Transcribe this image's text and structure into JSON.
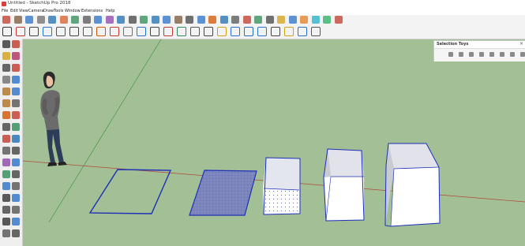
{
  "window": {
    "title": "Untitled - SketchUp Pro 2018"
  },
  "menubar": {
    "items": [
      "File",
      "Edit",
      "View",
      "Camera",
      "Draw",
      "Tools",
      "Window",
      "Extensions",
      "Help"
    ]
  },
  "toolbar_row1": {
    "icon_colors": [
      "#c0392b",
      "#7a5a3a",
      "#2a72c8",
      "#6e6e6e",
      "#1f6fb2",
      "#d65f2e",
      "#2e8b57",
      "#555555",
      "#2a72c8",
      "#8e44ad",
      "#1f6fb2",
      "#444444",
      "#2e8b57",
      "#1f6fb2",
      "#2a72c8",
      "#7a5a3a",
      "#444444",
      "#2a72c8",
      "#d35400",
      "#1f6fb2",
      "#555555",
      "#c0392b",
      "#2e8b57",
      "#444444",
      "#d4a017",
      "#2a72c8",
      "#e67e22",
      "#1fb1c8",
      "#27ae60",
      "#c0392b"
    ]
  },
  "toolbar_row2": {
    "icon_colors": [
      "#333333",
      "#c0392b",
      "#444444",
      "#2a72c8",
      "#555555",
      "#444444",
      "#555555",
      "#d35400",
      "#c0392b",
      "#6e6e6e",
      "#2a72c8",
      "#444444",
      "#c0392b",
      "#2e8b57",
      "#555555",
      "#444444",
      "#d4a017",
      "#2a72c8",
      "#1f6fb2",
      "#2a72c8",
      "#444444",
      "#d4a017",
      "#2a72c8",
      "#555555"
    ]
  },
  "left_toolbar": {
    "icon_colors": [
      "#333333",
      "#c0392b",
      "#d4a017",
      "#b03060",
      "#444444",
      "#c0392b",
      "#6e6e6e",
      "#2a72c8",
      "#b07020",
      "#2a72c8",
      "#b07020",
      "#555555",
      "#d35400",
      "#c0392b",
      "#444444",
      "#2e8b57",
      "#c0392b",
      "#1f6fb2",
      "#555555",
      "#444444",
      "#8e44ad",
      "#2a72c8",
      "#2e8b57",
      "#444444",
      "#2a72c8",
      "#555555",
      "#333333",
      "#2a72c8",
      "#444444",
      "#555555",
      "#333333",
      "#2a72c8",
      "#555555",
      "#444444"
    ]
  },
  "tray": {
    "title": "Selection Toys",
    "close_glyph": "×",
    "icons": [
      "select-all-icon",
      "select-edges-icon",
      "select-faces-icon",
      "deselect-icon",
      "select-groups-icon",
      "select-components-icon",
      "invert-selection-icon",
      "hide-icon"
    ]
  },
  "viewport": {
    "sky_color": "#a2bf95",
    "selection_color": "#1e2fb8",
    "face_color": "#ffffff",
    "top_face_color": "#e2e3ea",
    "side_face_color": "#c9cbd3"
  }
}
